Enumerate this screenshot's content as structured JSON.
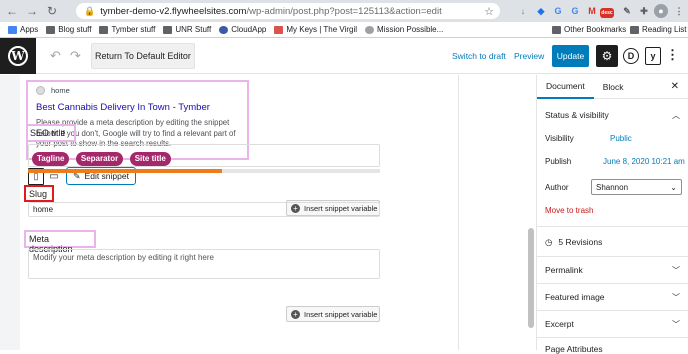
{
  "browser": {
    "url_host": "tymber-demo-v2.flywheelsites.com",
    "url_path": "/wp-admin/post.php?post=125113&action=edit",
    "bookmarks": [
      "Apps",
      "Blog stuff",
      "Tymber stuff",
      "UNR Stuff",
      "CloudApp",
      "My Keys | The Virgil",
      "Mission Possible..."
    ],
    "other_bookmarks": "Other Bookmarks",
    "reading_list": "Reading List",
    "ext_badge": "desc"
  },
  "toolbar": {
    "return_label": "Return To Default Editor",
    "switch_draft": "Switch to draft",
    "preview": "Preview",
    "update": "Update",
    "d_label": "D",
    "y_label": "y"
  },
  "snippet": {
    "breadcrumb": "home",
    "title": "Best Cannabis Delivery In Town - Tymber",
    "description": "Please provide a meta description by editing the snippet below. If you don't, Google will try to find a relevant part of your post to show in the search results.",
    "edit_snippet": "Edit snippet"
  },
  "seo": {
    "label": "SEO title",
    "insert_var": "Insert snippet variable",
    "pills": [
      "Tagline",
      "Separator",
      "Site title"
    ],
    "progress_fraction": 0.55
  },
  "slug": {
    "label": "Slug",
    "value": "home"
  },
  "meta": {
    "label": "Meta description",
    "insert_var": "Insert snippet variable",
    "placeholder": "Modify your meta description by editing it right here"
  },
  "sidebar": {
    "tab_document": "Document",
    "tab_block": "Block",
    "status_heading": "Status & visibility",
    "visibility_label": "Visibility",
    "visibility_value": "Public",
    "publish_label": "Publish",
    "publish_value": "June 8, 2020 10:21 am",
    "author_label": "Author",
    "author_value": "Shannon",
    "trash": "Move to trash",
    "revisions": "5 Revisions",
    "permalink": "Permalink",
    "featured_image": "Featured image",
    "excerpt": "Excerpt",
    "page_attributes": "Page Attributes"
  }
}
